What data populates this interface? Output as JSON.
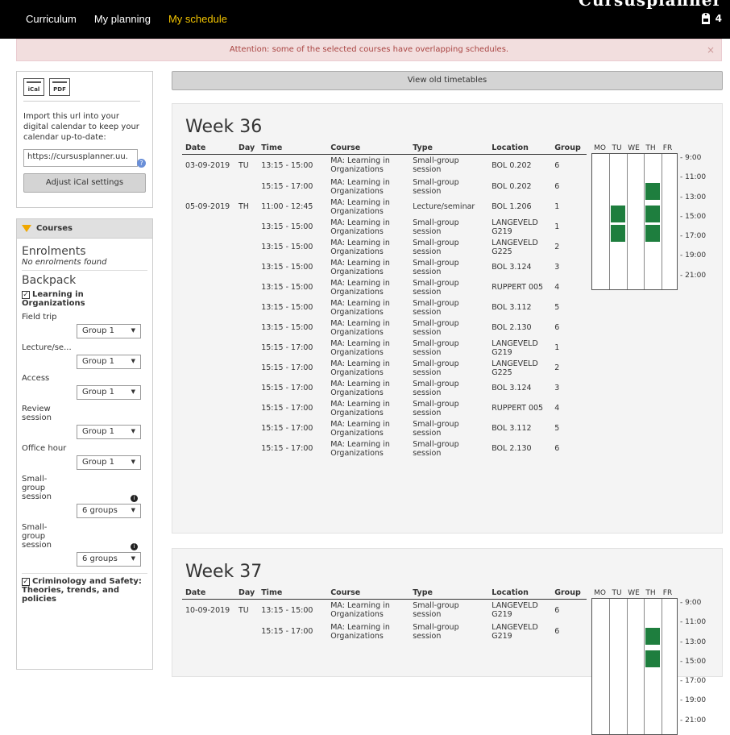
{
  "topbar": {
    "brand_peek": "Cursusplanner",
    "nav": [
      {
        "label": "Curriculum",
        "active": false
      },
      {
        "label": "My planning",
        "active": false
      },
      {
        "label": "My schedule",
        "active": true
      }
    ],
    "cart_count": "4"
  },
  "alert": {
    "text": "Attention: some of the selected courses have overlapping schedules.",
    "close": "×"
  },
  "ical": {
    "icons": [
      "iCal",
      "PDF"
    ],
    "text": "Import this url into your digital calendar to keep your calendar up-to-date:",
    "url_value": "https://cursusplanner.uu.",
    "adjust_label": "Adjust iCal settings"
  },
  "courses_panel": {
    "title": "Courses",
    "enrolments_heading": "Enrolments",
    "no_enrolments": "No enrolments found",
    "backpack_heading": "Backpack",
    "course1": {
      "title": "Learning in Organizations",
      "activities": [
        {
          "label": "Field trip",
          "value": "Group 1"
        },
        {
          "label": "Lecture/se...",
          "value": "Group 1"
        },
        {
          "label": "Access",
          "value": "Group 1"
        },
        {
          "label": "Review session",
          "value": "Group 1"
        },
        {
          "label": "Office hour",
          "value": "Group 1"
        },
        {
          "label": "Small-group session",
          "value": "6 groups"
        },
        {
          "label": "Small-group session",
          "value": "6 groups"
        }
      ]
    },
    "course2": {
      "title": "Criminology and Safety: Theories, trends, and policies"
    }
  },
  "old_timetables_label": "View old timetables",
  "columns": [
    "Date",
    "Day",
    "Time",
    "Course",
    "Type",
    "Location",
    "Group"
  ],
  "grid_days": [
    "MO",
    "TU",
    "WE",
    "TH",
    "FR"
  ],
  "grid_times": [
    "9:00",
    "11:00",
    "13:00",
    "15:00",
    "17:00",
    "19:00",
    "21:00"
  ],
  "weeks": [
    {
      "title": "Week 36",
      "rows": [
        [
          "03-09-2019",
          "TU",
          "13:15 - 15:00",
          "MA: Learning in Organizations",
          "Small-group session",
          "BOL 0.202",
          "6"
        ],
        [
          "",
          "",
          "15:15 - 17:00",
          "MA: Learning in Organizations",
          "Small-group session",
          "BOL 0.202",
          "6"
        ],
        [
          "05-09-2019",
          "TH",
          "11:00 - 12:45",
          "MA: Learning in Organizations",
          "Lecture/seminar",
          "BOL 1.206",
          "1"
        ],
        [
          "",
          "",
          "13:15 - 15:00",
          "MA: Learning in Organizations",
          "Small-group session",
          "LANGEVELD G219",
          "1"
        ],
        [
          "",
          "",
          "13:15 - 15:00",
          "MA: Learning in Organizations",
          "Small-group session",
          "LANGEVELD G225",
          "2"
        ],
        [
          "",
          "",
          "13:15 - 15:00",
          "MA: Learning in Organizations",
          "Small-group session",
          "BOL 3.124",
          "3"
        ],
        [
          "",
          "",
          "13:15 - 15:00",
          "MA: Learning in Organizations",
          "Small-group session",
          "RUPPERT 005",
          "4"
        ],
        [
          "",
          "",
          "13:15 - 15:00",
          "MA: Learning in Organizations",
          "Small-group session",
          "BOL 3.112",
          "5"
        ],
        [
          "",
          "",
          "13:15 - 15:00",
          "MA: Learning in Organizations",
          "Small-group session",
          "BOL 2.130",
          "6"
        ],
        [
          "",
          "",
          "15:15 - 17:00",
          "MA: Learning in Organizations",
          "Small-group session",
          "LANGEVELD G219",
          "1"
        ],
        [
          "",
          "",
          "15:15 - 17:00",
          "MA: Learning in Organizations",
          "Small-group session",
          "LANGEVELD G225",
          "2"
        ],
        [
          "",
          "",
          "15:15 - 17:00",
          "MA: Learning in Organizations",
          "Small-group session",
          "BOL 3.124",
          "3"
        ],
        [
          "",
          "",
          "15:15 - 17:00",
          "MA: Learning in Organizations",
          "Small-group session",
          "RUPPERT 005",
          "4"
        ],
        [
          "",
          "",
          "15:15 - 17:00",
          "MA: Learning in Organizations",
          "Small-group session",
          "BOL 3.112",
          "5"
        ],
        [
          "",
          "",
          "15:15 - 17:00",
          "MA: Learning in Organizations",
          "Small-group session",
          "BOL 2.130",
          "6"
        ]
      ],
      "blocks": [
        {
          "day": 1,
          "start": 13.25,
          "end": 15.0
        },
        {
          "day": 1,
          "start": 15.25,
          "end": 17.0
        },
        {
          "day": 3,
          "start": 11.0,
          "end": 12.75
        },
        {
          "day": 3,
          "start": 13.25,
          "end": 15.0
        },
        {
          "day": 3,
          "start": 15.25,
          "end": 17.0
        }
      ]
    },
    {
      "title": "Week 37",
      "rows": [
        [
          "10-09-2019",
          "TU",
          "13:15 - 15:00",
          "MA: Learning in Organizations",
          "Small-group session",
          "LANGEVELD G219",
          "6"
        ],
        [
          "",
          "",
          "15:15 - 17:00",
          "MA: Learning in Organizations",
          "Small-group session",
          "LANGEVELD G219",
          "6"
        ]
      ],
      "blocks": [
        {
          "day": 3,
          "start": 11.0,
          "end": 12.75
        },
        {
          "day": 3,
          "start": 13.25,
          "end": 15.0
        }
      ]
    }
  ]
}
